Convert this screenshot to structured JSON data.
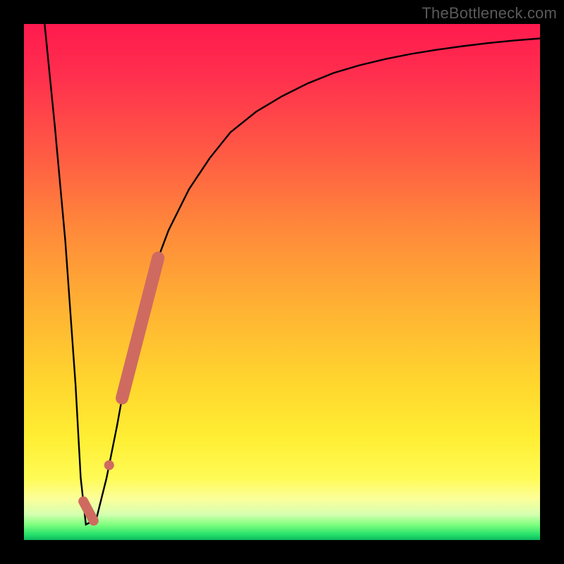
{
  "watermark": "TheBottleneck.com",
  "colors": {
    "frame": "#000000",
    "curve": "#000000",
    "highlight": "#cf6a60"
  },
  "chart_data": {
    "type": "line",
    "title": "",
    "xlabel": "",
    "ylabel": "",
    "xlim": [
      0,
      100
    ],
    "ylim": [
      0,
      100
    ],
    "series": [
      {
        "name": "curve",
        "x": [
          4,
          6,
          8,
          10,
          11,
          12,
          14,
          16,
          18,
          20,
          22,
          25,
          28,
          32,
          36,
          40,
          45,
          50,
          55,
          60,
          65,
          70,
          75,
          80,
          85,
          90,
          95,
          100
        ],
        "y": [
          100,
          80,
          58,
          30,
          12,
          3,
          4,
          12,
          22,
          33,
          42,
          52,
          60,
          68,
          74,
          79,
          83,
          86,
          88.5,
          90.5,
          92,
          93.2,
          94.2,
          95,
          95.7,
          96.3,
          96.8,
          97.2
        ]
      }
    ],
    "annotations": [
      {
        "kind": "highlight-segment",
        "x_range": [
          19,
          26
        ],
        "note": "salmon tilted bar on rising limb"
      },
      {
        "kind": "highlight-dot",
        "x": 16.5
      },
      {
        "kind": "highlight-mini",
        "x_range": [
          11.5,
          13.5
        ],
        "note": "small salmon mark at valley bottom"
      }
    ],
    "grid": false,
    "legend": false
  }
}
